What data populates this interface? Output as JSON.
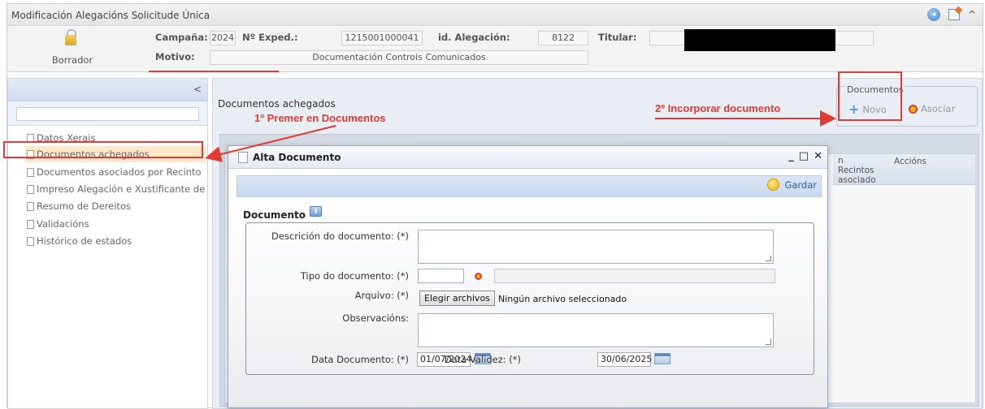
{
  "window": {
    "title": "Modificación Alegacións Solicitude Única",
    "icons": [
      "info-circle-icon",
      "edit-icon",
      "chevron-up-icon"
    ]
  },
  "header": {
    "status_label": "Borrador",
    "campaign_label": "Campaña:",
    "campaign_value": "2024",
    "expedient_label": "Nº Exped.:",
    "expedient_value": "1215001000041",
    "allegation_label": "id. Alegación:",
    "allegation_value": "8122",
    "holder_label": "Titular:",
    "holder_value": "",
    "reason_label": "Motivo:",
    "reason_value": "Documentación Controis Comunicados"
  },
  "sidebar": {
    "collapse_glyph": "<",
    "search_placeholder": "",
    "items": [
      {
        "label": "Datos Xerais"
      },
      {
        "label": "Documentos achegados"
      },
      {
        "label": "Documentos asociados por Recinto"
      },
      {
        "label": "Impreso Alegación e Xustificante de Re"
      },
      {
        "label": "Resumo de Dereitos"
      },
      {
        "label": "Validacións"
      },
      {
        "label": "Histórico de estados"
      }
    ],
    "active_index": 1
  },
  "main": {
    "title": "Documentos achegados",
    "documents_group_label": "Documentos",
    "new_button": "Novo",
    "associate_button": "Asociar",
    "grid_columns": [
      "n Recintos asociado",
      "Accións"
    ]
  },
  "modal": {
    "title": "Alta Documento",
    "controls": [
      "_",
      "□",
      "✕"
    ],
    "save_button": "Gardar",
    "section_title": "Documento",
    "fields": {
      "description_label": "Descrición do documento: (*)",
      "description_value": "",
      "type_label": "Tipo do documento: (*)",
      "type_code": "",
      "type_desc": "",
      "file_label": "Arquivo: (*)",
      "file_button": "Elegir archivos",
      "file_status": "Ningún archivo seleccionado",
      "observations_label": "Observacións:",
      "observations_value": "",
      "doc_date_label": "Data Documento: (*)",
      "doc_date_value": "01/07/2024",
      "valid_date_label": "Data Validez: (*)",
      "valid_date_value": "30/06/2025"
    }
  },
  "annotations": {
    "step1": "1º Premer en Documentos",
    "step2": "2º Incorporar documento",
    "color": "#e53935"
  }
}
